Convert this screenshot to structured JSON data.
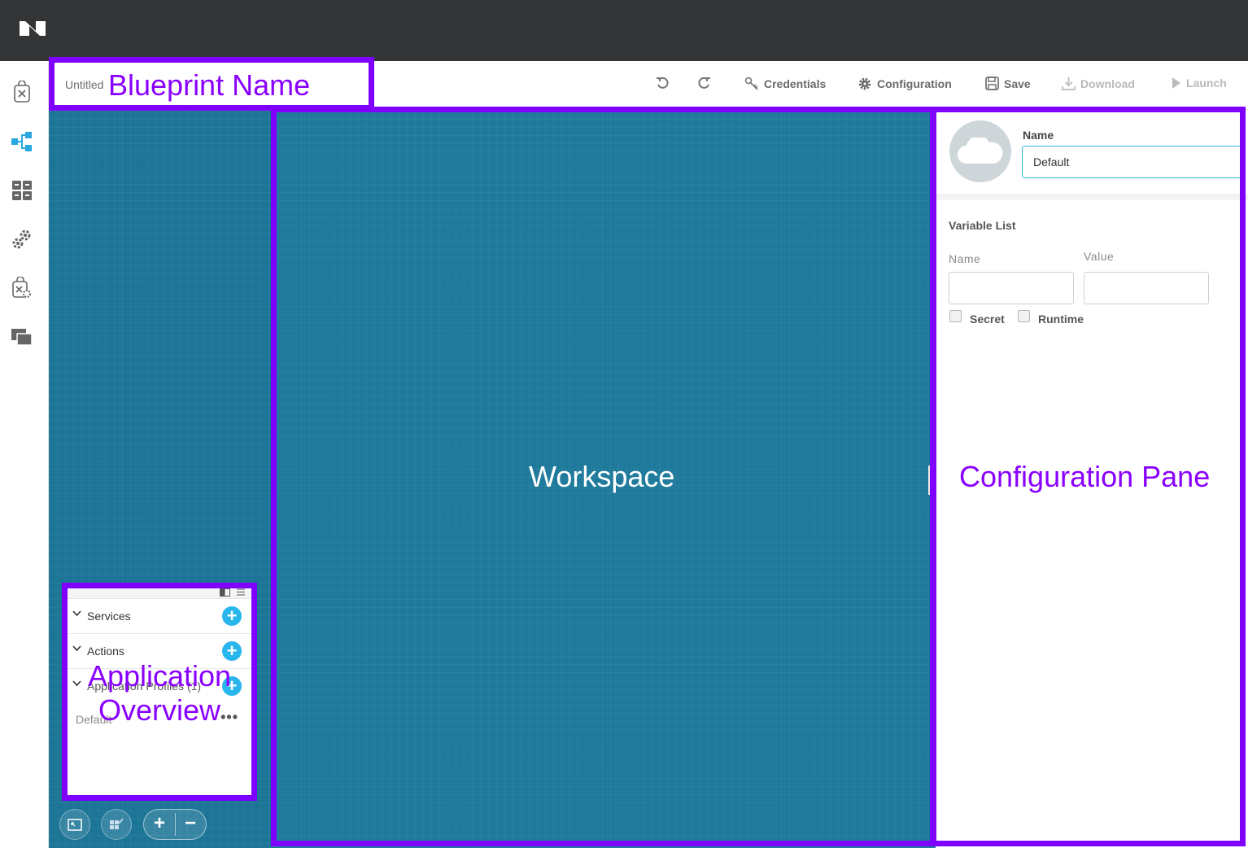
{
  "top_bar": {
    "logo": "nutanix-logo"
  },
  "left_nav": {
    "items": [
      {
        "icon": "blueprint-bag-icon"
      },
      {
        "icon": "tree-icon",
        "active": true
      },
      {
        "icon": "grid-icon"
      },
      {
        "icon": "gears-icon"
      },
      {
        "icon": "marketplace-bag-icon"
      },
      {
        "icon": "windows-icon"
      }
    ]
  },
  "header": {
    "blueprint_name": "Untitled",
    "tools": {
      "undo": "undo-icon",
      "redo": "redo-icon",
      "credentials": "Credentials",
      "configuration": "Configuration",
      "save": "Save",
      "download": "Download",
      "launch": "Launch"
    }
  },
  "overview": {
    "sections": [
      {
        "label": "Services"
      },
      {
        "label": "Actions"
      },
      {
        "label": "Application Profiles (1)"
      }
    ],
    "profile_default": "Default",
    "more": "•••"
  },
  "config_pane": {
    "name_label": "Name",
    "name_value": "Default",
    "variable_list_title": "Variable List",
    "var_name_label": "Name",
    "var_value_label": "Value",
    "secret_label": "Secret",
    "runtime_label": "Runtime"
  },
  "annotations": {
    "blueprint_name": "Blueprint Name",
    "workspace": "Workspace",
    "configuration_pane": "Configuration Pane",
    "application_overview_line1": "Application",
    "application_overview_line2": "Overview"
  },
  "colors": {
    "top_bar": "#343537",
    "canvas": "#1f7a9c",
    "annotation": "#8000ff",
    "accent": "#29b6ec"
  }
}
